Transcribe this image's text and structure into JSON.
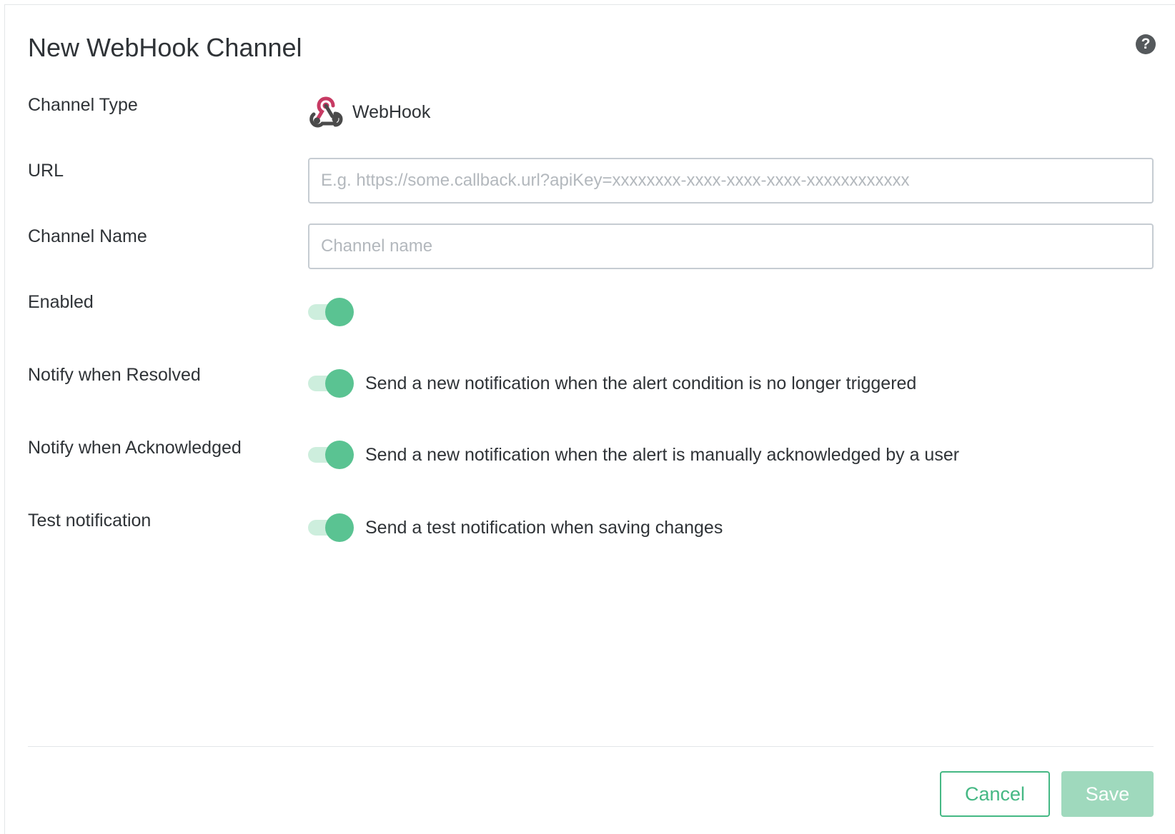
{
  "dialog": {
    "title": "New WebHook Channel",
    "help_icon": "question-circle-icon",
    "help_glyph": "?"
  },
  "fields": {
    "channel_type": {
      "label": "Channel Type",
      "value": "WebHook",
      "icon": "webhook-icon"
    },
    "url": {
      "label": "URL",
      "value": "",
      "placeholder": "E.g. https://some.callback.url?apiKey=xxxxxxxx-xxxx-xxxx-xxxx-xxxxxxxxxxxx"
    },
    "channel_name": {
      "label": "Channel Name",
      "value": "",
      "placeholder": "Channel name"
    },
    "enabled": {
      "label": "Enabled",
      "checked": true
    },
    "notify_resolved": {
      "label": "Notify when Resolved",
      "checked": true,
      "description": "Send a new notification when the alert condition is no longer triggered"
    },
    "notify_acknowledged": {
      "label": "Notify when Acknowledged",
      "checked": true,
      "description": "Send a new notification when the alert is manually acknowledged by a user"
    },
    "test_notification": {
      "label": "Test notification",
      "checked": true,
      "description": "Send a test notification when saving changes"
    }
  },
  "footer": {
    "cancel_label": "Cancel",
    "save_label": "Save"
  },
  "colors": {
    "accent": "#45b884",
    "toggle_on_knob": "#5ac392",
    "toggle_on_track": "#cdeedd",
    "save_disabled": "#9fd9bd",
    "webhook_red": "#c73a63",
    "webhook_dark": "#4a4a4a"
  }
}
